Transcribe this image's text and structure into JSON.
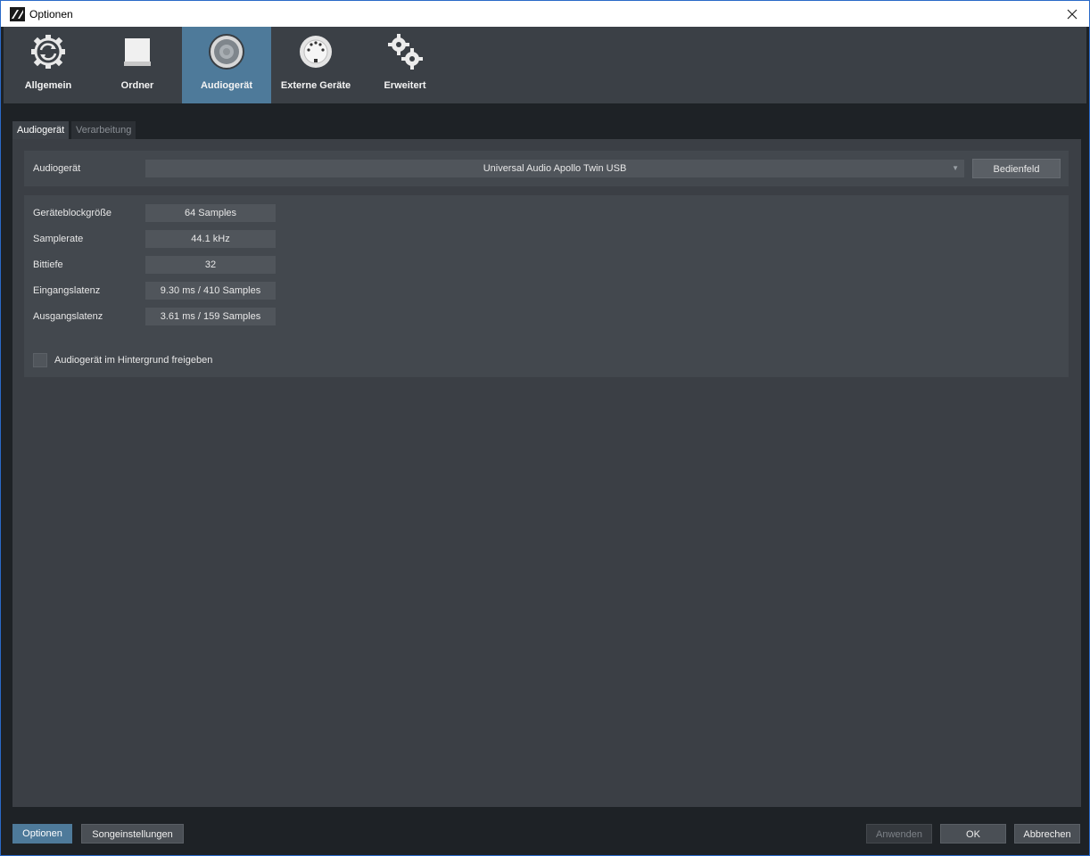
{
  "window": {
    "title": "Optionen"
  },
  "categories": [
    {
      "label": "Allgemein",
      "icon": "sync-gear-icon"
    },
    {
      "label": "Ordner",
      "icon": "drive-icon"
    },
    {
      "label": "Audiogerät",
      "icon": "speaker-icon",
      "active": true
    },
    {
      "label": "Externe Geräte",
      "icon": "midi-connector-icon"
    },
    {
      "label": "Erweitert",
      "icon": "gears-icon"
    }
  ],
  "subtabs": [
    {
      "label": "Audiogerät",
      "active": true
    },
    {
      "label": "Verarbeitung",
      "active": false
    }
  ],
  "device": {
    "label": "Audiogerät",
    "selected": "Universal Audio Apollo Twin USB",
    "control_panel_button": "Bedienfeld"
  },
  "info": [
    {
      "key": "Geräteblockgröße",
      "value": "64 Samples"
    },
    {
      "key": "Samplerate",
      "value": "44.1 kHz"
    },
    {
      "key": "Bittiefe",
      "value": "32"
    },
    {
      "key": "Eingangslatenz",
      "value": "9.30 ms / 410 Samples"
    },
    {
      "key": "Ausgangslatenz",
      "value": "3.61 ms / 159 Samples"
    }
  ],
  "release_in_background": {
    "label": "Audiogerät im Hintergrund freigeben",
    "checked": false
  },
  "footer": {
    "options": "Optionen",
    "song_settings": "Songeinstellungen",
    "apply": "Anwenden",
    "ok": "OK",
    "cancel": "Abbrechen"
  },
  "colors": {
    "accent": "#4e7a9a",
    "panel": "#3b3f45",
    "window_border": "#2a6ac8"
  }
}
